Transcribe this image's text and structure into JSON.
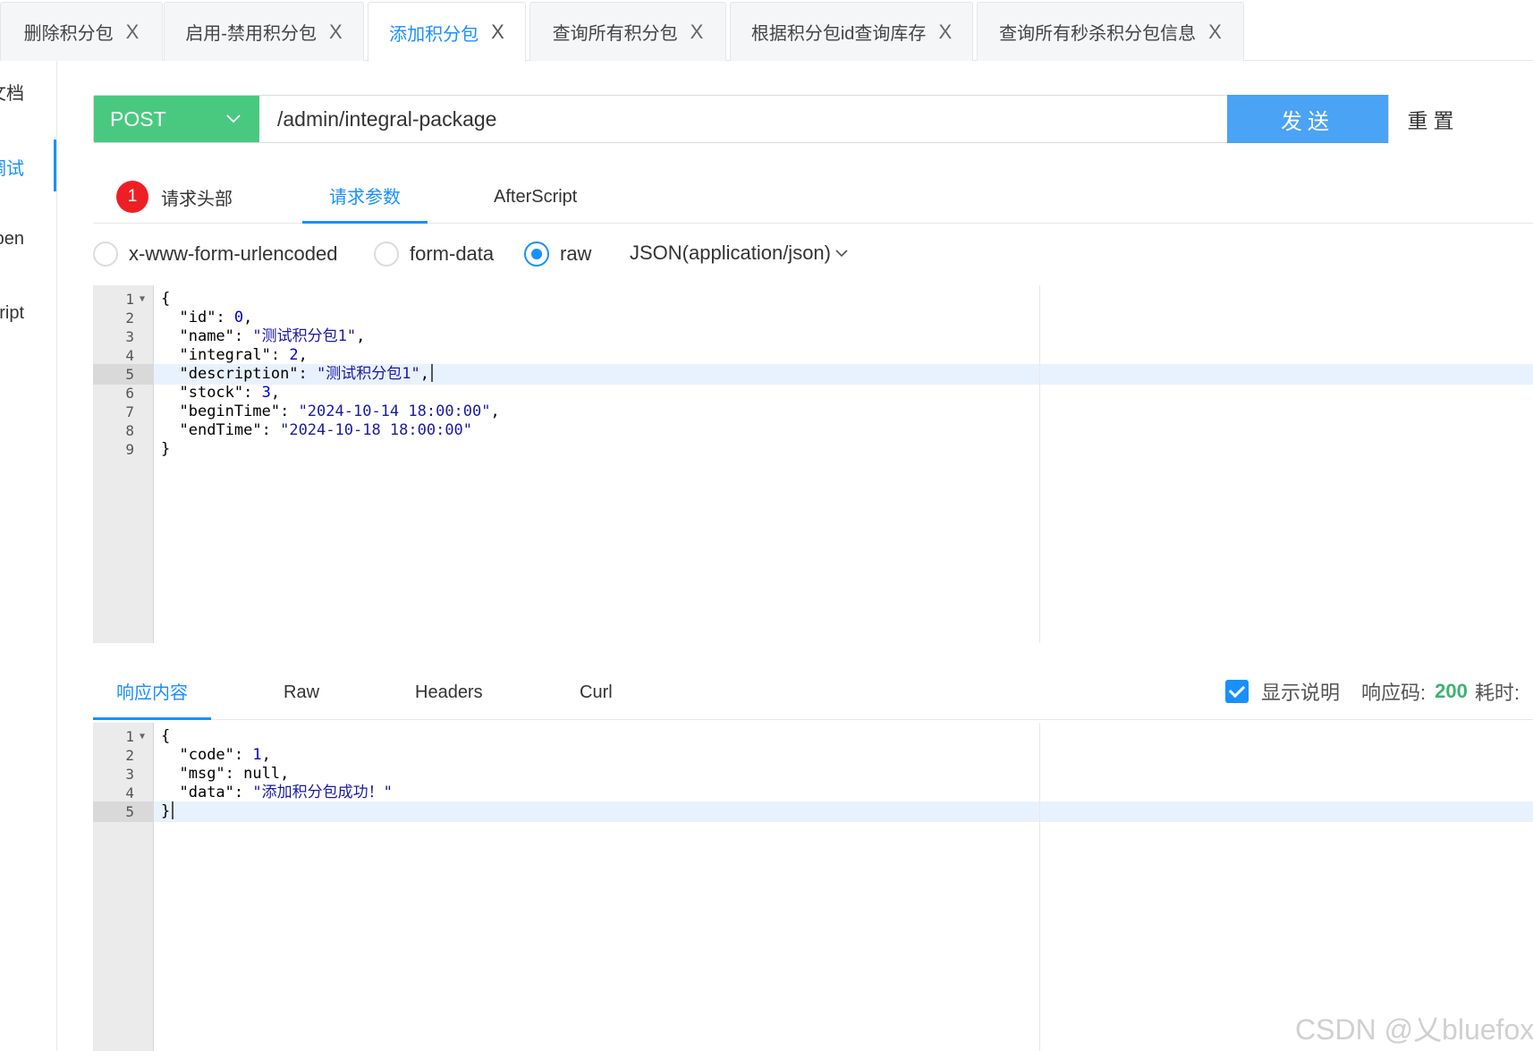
{
  "tabs": [
    {
      "label": "删除积分包",
      "active": false
    },
    {
      "label": "启用-禁用积分包",
      "active": false
    },
    {
      "label": "添加积分包",
      "active": true
    },
    {
      "label": "查询所有积分包",
      "active": false
    },
    {
      "label": "根据积分包id查询库存",
      "active": false
    },
    {
      "label": "查询所有秒杀积分包信息",
      "active": false
    }
  ],
  "tab_close": "X",
  "sidebar": {
    "items": [
      "文档",
      "调试",
      "Open",
      "Script"
    ]
  },
  "request": {
    "method": "POST",
    "url": "/admin/integral-package",
    "send_label": "发送",
    "reset_label": "重置"
  },
  "request_tabs": {
    "headers_badge": "1",
    "headers_label": "请求头部",
    "params_label": "请求参数",
    "afterscript_label": "AfterScript"
  },
  "body_types": {
    "urlencoded": "x-www-form-urlencoded",
    "formdata": "form-data",
    "raw": "raw",
    "selected": "raw",
    "content_type": "JSON(application/json)"
  },
  "request_body": {
    "lines": [
      "{",
      "  \"id\": 0,",
      "  \"name\": \"测试积分包1\",",
      "  \"integral\": 2,",
      "  \"description\": \"测试积分包1\",",
      "  \"stock\": 3,",
      "  \"beginTime\": \"2024-10-14 18:00:00\",",
      "  \"endTime\": \"2024-10-18 18:00:00\"",
      "}"
    ],
    "active_line": 5
  },
  "response_tabs": {
    "content_label": "响应内容",
    "raw_label": "Raw",
    "headers_label": "Headers",
    "curl_label": "Curl"
  },
  "response_meta": {
    "show_desc_label": "显示说明",
    "status_label": "响应码:",
    "status_code": "200",
    "time_label": "耗时:"
  },
  "response_body": {
    "lines": [
      "{",
      "  \"code\": 1,",
      "  \"msg\": null,",
      "  \"data\": \"添加积分包成功！\"",
      "}"
    ],
    "active_line": 5
  },
  "watermark": "CSDN @乂bluefox",
  "colors": {
    "accent": "#1890ff",
    "method_bg": "#49c97f",
    "send_bg": "#4aa3f5",
    "badge": "#ee1f24",
    "status_ok": "#3cb371"
  }
}
